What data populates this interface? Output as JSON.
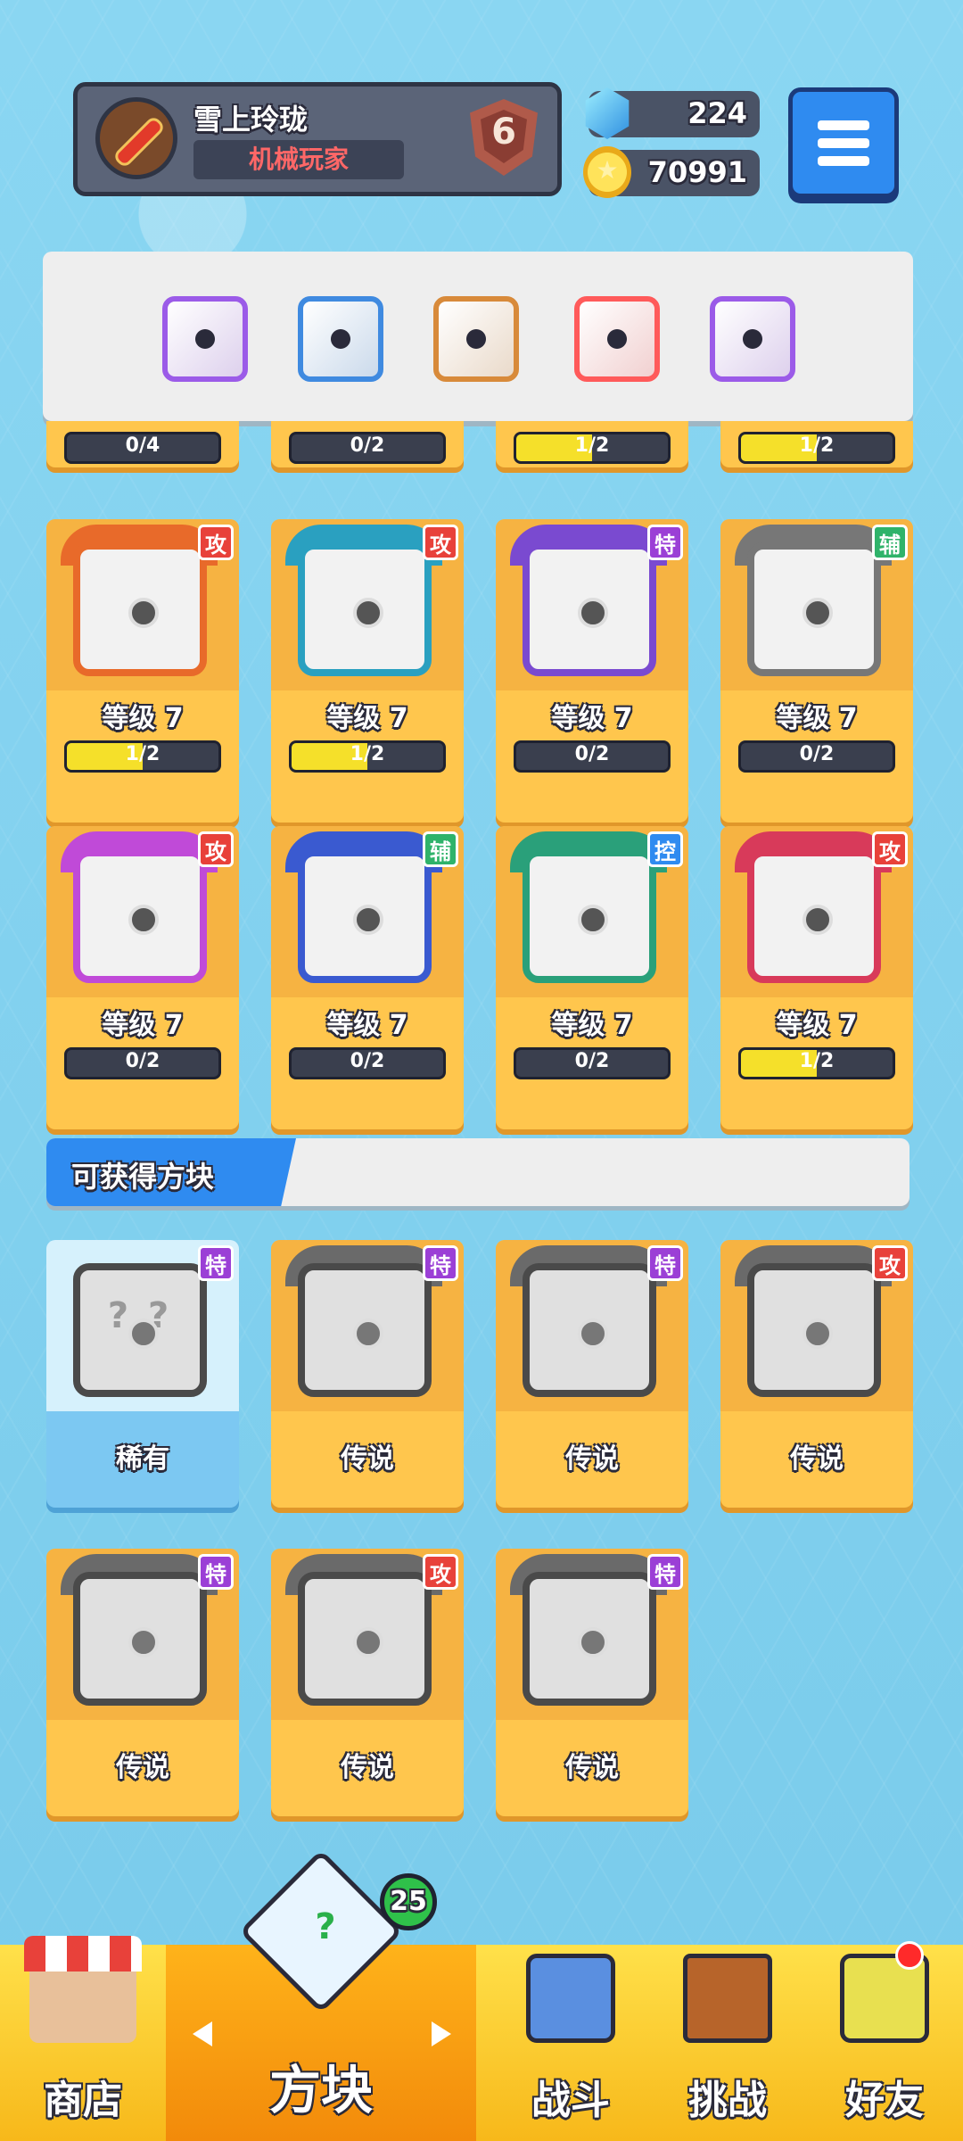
{
  "player": {
    "name": "雪上玲珑",
    "title": "机械玩家",
    "rank": "6"
  },
  "currency": {
    "gems": "224",
    "coins": "70991"
  },
  "colors": {
    "gold": "#ffc64d",
    "blue": "#2f8bf0",
    "attack": "#e8413a",
    "support": "#2fb36a",
    "control": "#2f8bf0",
    "special": "#9b3fd6"
  },
  "equipped": [
    {
      "name": "purple-dice-icon",
      "color": "#9b5be8"
    },
    {
      "name": "snowflake-dice-icon",
      "color": "#3f8ae0"
    },
    {
      "name": "sand-dice-icon",
      "color": "#d88a3a"
    },
    {
      "name": "rainbow-dice-icon",
      "color": "#ff5a5a"
    },
    {
      "name": "cracked-dice-icon",
      "color": "#9b5be8"
    }
  ],
  "partial_row": [
    {
      "progress": "0/4",
      "fill": 0
    },
    {
      "progress": "0/2",
      "fill": 0
    },
    {
      "progress": "1/2",
      "fill": 0.5
    },
    {
      "progress": "1/2",
      "fill": 0.5
    }
  ],
  "owned": [
    {
      "name": "gun-dice",
      "tag": "攻",
      "tag_color": "#e8413a",
      "level": "等级 7",
      "progress": "1/2",
      "fill": 0.5,
      "frame": "#e86a2a"
    },
    {
      "name": "whirlpool-dice",
      "tag": "攻",
      "tag_color": "#e8413a",
      "level": "等级 7",
      "progress": "1/2",
      "fill": 0.5,
      "frame": "#2aa0c0"
    },
    {
      "name": "mist-dice",
      "tag": "特",
      "tag_color": "#9b3fd6",
      "level": "等级 7",
      "progress": "0/2",
      "fill": 0,
      "frame": "#7a4ad0"
    },
    {
      "name": "clock-dice",
      "tag": "辅",
      "tag_color": "#2fb36a",
      "level": "等级 7",
      "progress": "0/2",
      "fill": 0,
      "frame": "#777777"
    },
    {
      "name": "combo-dice",
      "tag": "攻",
      "tag_color": "#e8413a",
      "level": "等级 7",
      "progress": "0/2",
      "fill": 0,
      "frame": "#c04ad8"
    },
    {
      "name": "moon-dice",
      "tag": "辅",
      "tag_color": "#2fb36a",
      "level": "等级 7",
      "progress": "0/2",
      "fill": 0,
      "frame": "#3a5ad0"
    },
    {
      "name": "wind-dice",
      "tag": "控",
      "tag_color": "#2f8bf0",
      "level": "等级 7",
      "progress": "0/2",
      "fill": 0,
      "frame": "#2aa07a"
    },
    {
      "name": "blackhole-dice",
      "tag": "攻",
      "tag_color": "#e8413a",
      "level": "等级 7",
      "progress": "1/2",
      "fill": 0.5,
      "frame": "#d83a5a"
    }
  ],
  "section_title": "可获得方块",
  "available": [
    {
      "name": "mystery-dice",
      "tag": "特",
      "tag_color": "#9b3fd6",
      "rarity": "稀有",
      "rare": true
    },
    {
      "name": "infinity-dice",
      "tag": "特",
      "tag_color": "#9b3fd6",
      "rarity": "传说"
    },
    {
      "name": "arrow-dice",
      "tag": "特",
      "tag_color": "#9b3fd6",
      "rarity": "传说"
    },
    {
      "name": "saw-dice",
      "tag": "攻",
      "tag_color": "#e8413a",
      "rarity": "传说"
    },
    {
      "name": "flame-dice",
      "tag": "特",
      "tag_color": "#9b3fd6",
      "rarity": "传说"
    },
    {
      "name": "star-dice",
      "tag": "攻",
      "tag_color": "#e8413a",
      "rarity": "传说"
    },
    {
      "name": "crest-dice",
      "tag": "特",
      "tag_color": "#9b3fd6",
      "rarity": "传说"
    }
  ],
  "nav": {
    "shop": "商店",
    "dice": "方块",
    "battle": "战斗",
    "challenge": "挑战",
    "friends": "好友",
    "dice_badge": "25",
    "dice_icon": "?"
  }
}
